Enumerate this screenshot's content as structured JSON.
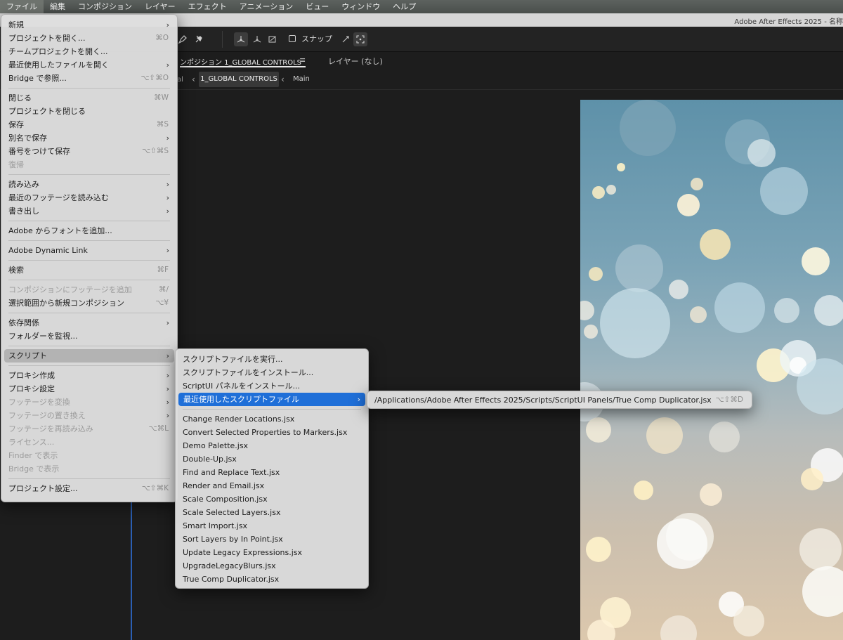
{
  "menubar": {
    "items": [
      "ファイル",
      "編集",
      "コンポジション",
      "レイヤー",
      "エフェクト",
      "アニメーション",
      "ビュー",
      "ウィンドウ",
      "ヘルプ"
    ]
  },
  "app": {
    "title": "Adobe After Effects 2025 - 名称"
  },
  "toolbar": {
    "snap_label": "スナップ",
    "snap_checked": false
  },
  "panel_tabs": {
    "comp_tab": "ンポジション 1_GLOBAL CONTROLS",
    "comp_menu_icon": "≡",
    "layer_tab": "レイヤー (なし)"
  },
  "breadcrumbs": {
    "prev": "al",
    "active": "1_GLOBAL CONTROLS",
    "next": "Main"
  },
  "file_menu": {
    "items": [
      {
        "label": "新規",
        "shortcut": "",
        "submenu": true,
        "disabled": false
      },
      {
        "label": "プロジェクトを開く...",
        "shortcut": "⌘O",
        "submenu": false,
        "disabled": false
      },
      {
        "label": "チームプロジェクトを開く...",
        "shortcut": "",
        "submenu": false,
        "disabled": false
      },
      {
        "label": "最近使用したファイルを開く",
        "shortcut": "",
        "submenu": true,
        "disabled": false
      },
      {
        "label": "Bridge で参照...",
        "shortcut": "⌥⇧⌘O",
        "submenu": false,
        "disabled": false
      },
      {
        "sep": true
      },
      {
        "label": "閉じる",
        "shortcut": "⌘W",
        "submenu": false,
        "disabled": false
      },
      {
        "label": "プロジェクトを閉じる",
        "shortcut": "",
        "submenu": false,
        "disabled": false
      },
      {
        "label": "保存",
        "shortcut": "⌘S",
        "submenu": false,
        "disabled": false
      },
      {
        "label": "別名で保存",
        "shortcut": "",
        "submenu": true,
        "disabled": false
      },
      {
        "label": "番号をつけて保存",
        "shortcut": "⌥⇧⌘S",
        "submenu": false,
        "disabled": false
      },
      {
        "label": "復帰",
        "shortcut": "",
        "submenu": false,
        "disabled": true
      },
      {
        "sep": true
      },
      {
        "label": "読み込み",
        "shortcut": "",
        "submenu": true,
        "disabled": false
      },
      {
        "label": "最近のフッテージを読み込む",
        "shortcut": "",
        "submenu": true,
        "disabled": false
      },
      {
        "label": "書き出し",
        "shortcut": "",
        "submenu": true,
        "disabled": false
      },
      {
        "sep": true
      },
      {
        "label": "Adobe からフォントを追加...",
        "shortcut": "",
        "submenu": false,
        "disabled": false
      },
      {
        "sep": true
      },
      {
        "label": "Adobe Dynamic Link",
        "shortcut": "",
        "submenu": true,
        "disabled": false
      },
      {
        "sep": true
      },
      {
        "label": "検索",
        "shortcut": "⌘F",
        "submenu": false,
        "disabled": false
      },
      {
        "sep": true
      },
      {
        "label": "コンポジションにフッテージを追加",
        "shortcut": "⌘/",
        "submenu": false,
        "disabled": true
      },
      {
        "label": "選択範囲から新規コンポジション",
        "shortcut": "⌥¥",
        "submenu": false,
        "disabled": false
      },
      {
        "sep": true
      },
      {
        "label": "依存関係",
        "shortcut": "",
        "submenu": true,
        "disabled": false
      },
      {
        "label": "フォルダーを監視...",
        "shortcut": "",
        "submenu": false,
        "disabled": false
      },
      {
        "sep": true
      },
      {
        "label": "スクリプト",
        "shortcut": "",
        "submenu": true,
        "disabled": false,
        "highlight": true
      },
      {
        "sep": true
      },
      {
        "label": "プロキシ作成",
        "shortcut": "",
        "submenu": true,
        "disabled": false
      },
      {
        "label": "プロキシ設定",
        "shortcut": "",
        "submenu": true,
        "disabled": false
      },
      {
        "label": "フッテージを変換",
        "shortcut": "",
        "submenu": true,
        "disabled": true
      },
      {
        "label": "フッテージの置き換え",
        "shortcut": "",
        "submenu": true,
        "disabled": true
      },
      {
        "label": "フッテージを再読み込み",
        "shortcut": "⌥⌘L",
        "submenu": false,
        "disabled": true
      },
      {
        "label": "ライセンス...",
        "shortcut": "",
        "submenu": false,
        "disabled": true
      },
      {
        "label": "Finder で表示",
        "shortcut": "",
        "submenu": false,
        "disabled": true
      },
      {
        "label": "Bridge で表示",
        "shortcut": "",
        "submenu": false,
        "disabled": true
      },
      {
        "sep": true
      },
      {
        "label": "プロジェクト設定...",
        "shortcut": "⌥⇧⌘K",
        "submenu": false,
        "disabled": false
      }
    ]
  },
  "scripts_submenu": {
    "items": [
      {
        "label": "スクリプトファイルを実行...",
        "submenu": false
      },
      {
        "label": "スクリプトファイルをインストール...",
        "submenu": false
      },
      {
        "label": "ScriptUI パネルをインストール...",
        "submenu": false
      },
      {
        "label": "最近使用したスクリプトファイル",
        "submenu": true,
        "selected": true
      },
      {
        "sep": true
      },
      {
        "label": "Change Render Locations.jsx",
        "submenu": false
      },
      {
        "label": "Convert Selected Properties to Markers.jsx",
        "submenu": false
      },
      {
        "label": "Demo Palette.jsx",
        "submenu": false
      },
      {
        "label": "Double-Up.jsx",
        "submenu": false
      },
      {
        "label": "Find and Replace Text.jsx",
        "submenu": false
      },
      {
        "label": "Render and Email.jsx",
        "submenu": false
      },
      {
        "label": "Scale Composition.jsx",
        "submenu": false
      },
      {
        "label": "Scale Selected Layers.jsx",
        "submenu": false
      },
      {
        "label": "Smart Import.jsx",
        "submenu": false
      },
      {
        "label": "Sort Layers by In Point.jsx",
        "submenu": false
      },
      {
        "label": "Update Legacy Expressions.jsx",
        "submenu": false
      },
      {
        "label": "UpgradeLegacyBlurs.jsx",
        "submenu": false
      },
      {
        "label": "True Comp Duplicator.jsx",
        "submenu": false
      }
    ]
  },
  "recent_scripts": {
    "items": [
      {
        "label": "/Applications/Adobe After Effects 2025/Scripts/ScriptUI Panels/True Comp Duplicator.jsx",
        "shortcut": "⌥⇧⌘D"
      }
    ]
  },
  "icons": {
    "pen": "pen-tool-icon",
    "pin": "puppet-pin-icon",
    "axis_local": "local-axis-icon",
    "axis_world": "world-axis-icon",
    "axis_view": "view-axis-icon",
    "snap_a": "snap-feature-icon",
    "snap_b": "snap-grid-icon"
  },
  "colors": {
    "menu_selection": "#1f6fd8",
    "timeline_indicator": "#2b5fb3",
    "viewer_sky_top": "#5e91a9",
    "viewer_sky_bottom": "#dcc8ad"
  }
}
